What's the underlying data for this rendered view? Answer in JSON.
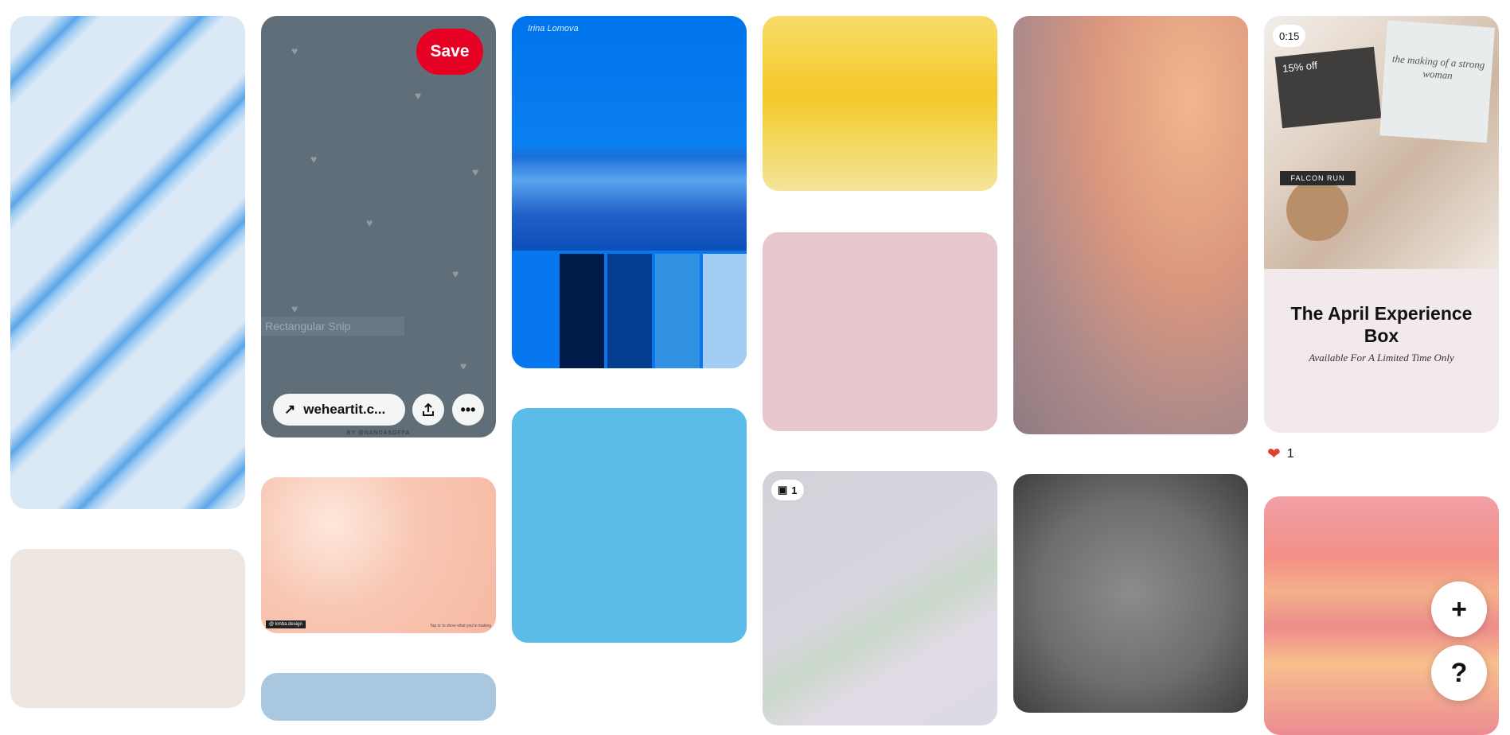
{
  "pins": [
    {
      "id": "blue-stripes"
    },
    {
      "id": "beige"
    },
    {
      "id": "hearts",
      "save_label": "Save",
      "link_label": "weheartit.c...",
      "credit": "BY @NANDASOFFA",
      "snip_text": "Rectangular Snip"
    },
    {
      "id": "peach-clouds",
      "tag_left": "@ kmba.design",
      "tag_right": "Tap or to show what you're making"
    },
    {
      "id": "sea-palette",
      "logo": "Irina Lomova",
      "swatches": [
        "#0677ee",
        "#001a4a",
        "#043c8f",
        "#3192e3",
        "#a4cdf4"
      ]
    },
    {
      "id": "sky-blue"
    },
    {
      "id": "yellow"
    },
    {
      "id": "pink"
    },
    {
      "id": "grey-gradient",
      "count": "1"
    },
    {
      "id": "sunset-clouds"
    },
    {
      "id": "dark-grey"
    },
    {
      "id": "april-box",
      "duration": "0:15",
      "card1_text": "15% off",
      "card2_text": "the making of a strong woman",
      "jar_label": "FALCON RUN",
      "title": "The April Experience Box",
      "subtitle": "Available For A Limited Time Only",
      "reaction_count": "1"
    },
    {
      "id": "coral-waves"
    }
  ],
  "fab": {
    "add_label": "+",
    "help_label": "?"
  },
  "colors": {
    "save_red": "#e60023"
  }
}
